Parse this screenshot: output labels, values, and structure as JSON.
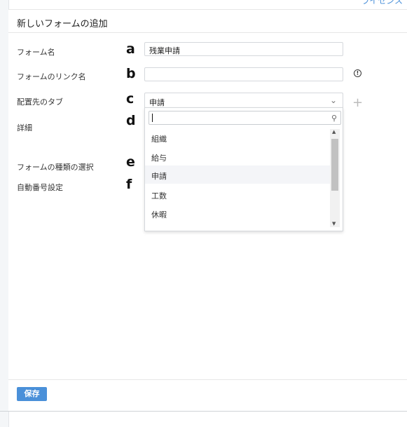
{
  "header": {
    "top_link": "ライセンス"
  },
  "modal": {
    "title": "新しいフォームの追加",
    "fields": {
      "form_name": {
        "label": "フォーム名",
        "letter": "a",
        "value": "残業申請"
      },
      "link_name": {
        "label": "フォームのリンク名",
        "letter": "b",
        "value": ""
      },
      "tab": {
        "label": "配置先のタブ",
        "letter": "c",
        "selected": "申請"
      },
      "detail": {
        "label": "詳細",
        "letter": "d"
      },
      "form_type": {
        "label": "フォームの種類の選択",
        "letter": "e"
      },
      "auto_number": {
        "label": "自動番号設定",
        "letter": "f"
      }
    },
    "dropdown": {
      "search_value": "",
      "options": [
        "組織",
        "給与",
        "申請",
        "工数",
        "休暇"
      ],
      "highlighted_index": 2
    },
    "save_label": "保存"
  },
  "icons": {
    "info": "info-icon",
    "chevron": "chevron-down-icon",
    "add": "plus-icon",
    "search": "search-icon"
  },
  "colors": {
    "accent": "#4a90d9",
    "highlight": "#f4f5f8"
  }
}
